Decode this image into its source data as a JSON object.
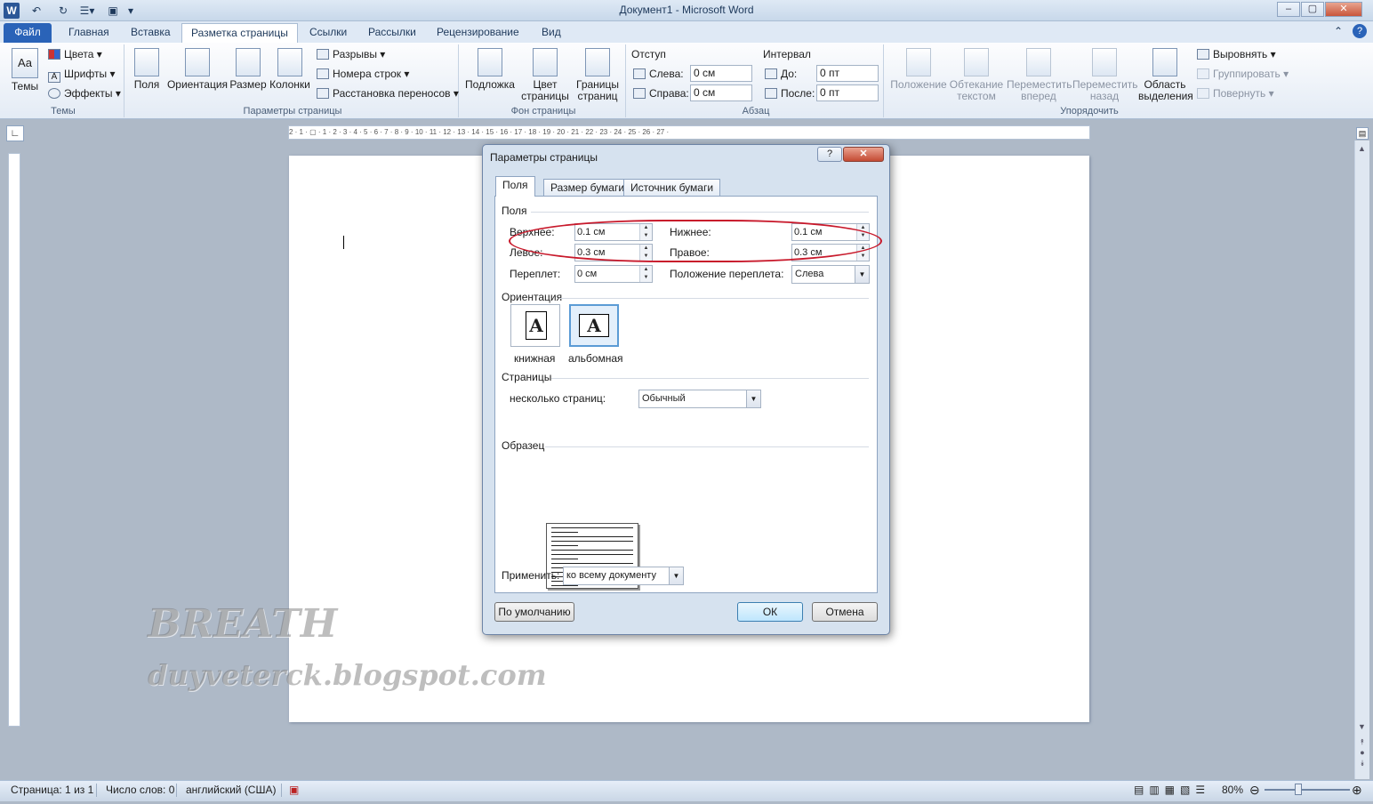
{
  "app": {
    "title": "Документ1  -  Microsoft Word"
  },
  "tabs": [
    "Файл",
    "Главная",
    "Вставка",
    "Разметка страницы",
    "Ссылки",
    "Рассылки",
    "Рецензирование",
    "Вид"
  ],
  "ribbon": {
    "themes": {
      "themes_label": "Темы",
      "colors": "Цвета",
      "fonts": "Шрифты",
      "effects": "Эффекты",
      "group": "Темы"
    },
    "page_setup": {
      "margins": "Поля",
      "orientation": "Ориентация",
      "size": "Размер",
      "columns": "Колонки",
      "breaks": "Разрывы",
      "line_numbers": "Номера строк",
      "hyphenation": "Расстановка переносов",
      "group": "Параметры страницы"
    },
    "background": {
      "watermark": "Подложка",
      "page_color_1": "Цвет",
      "page_color_2": "страницы",
      "page_borders_1": "Границы",
      "page_borders_2": "страниц",
      "group": "Фон страницы"
    },
    "paragraph": {
      "indent": "Отступ",
      "left": "Слева:",
      "right": "Справа:",
      "left_val": "0 см",
      "right_val": "0 см",
      "spacing": "Интервал",
      "before": "До:",
      "after": "После:",
      "before_val": "0 пт",
      "after_val": "0 пт",
      "group": "Абзац"
    },
    "arrange": {
      "position": "Положение",
      "wrap_1": "Обтекание",
      "wrap_2": "текстом",
      "forward_1": "Переместить",
      "forward_2": "вперед",
      "backward_1": "Переместить",
      "backward_2": "назад",
      "selection_1": "Область",
      "selection_2": "выделения",
      "align": "Выровнять",
      "group_btn": "Группировать",
      "rotate": "Повернуть",
      "group": "Упорядочить"
    }
  },
  "dialog": {
    "title": "Параметры страницы",
    "tabs": [
      "Поля",
      "Размер бумаги",
      "Источник бумаги"
    ],
    "margins_section": "Поля",
    "top_label": "Верхнее:",
    "top_value": "0.1 см",
    "bottom_label": "Нижнее:",
    "bottom_value": "0.1 см",
    "left_label": "Левое:",
    "left_value": "0.3 см",
    "right_label": "Правое:",
    "right_value": "0.3 см",
    "gutter_label": "Переплет:",
    "gutter_value": "0 см",
    "gutter_pos_label": "Положение переплета:",
    "gutter_pos_value": "Слева",
    "orientation_section": "Ориентация",
    "portrait": "книжная",
    "landscape": "альбомная",
    "orient_glyph": "A",
    "pages_section": "Страницы",
    "multiple_pages_label": "несколько страниц:",
    "multiple_pages_value": "Обычный",
    "preview_section": "Образец",
    "apply_label": "Применить:",
    "apply_value": "ко всему документу",
    "default_btn": "По умолчанию",
    "ok_btn": "ОК",
    "cancel_btn": "Отмена",
    "help": "?",
    "close": "✕"
  },
  "watermark": {
    "line1": "BREATH",
    "line2": "duyveterck.blogspot.com"
  },
  "status": {
    "page": "Страница: 1 из 1",
    "words": "Число слов: 0",
    "lang": "английский (США)",
    "zoom": "80%"
  },
  "ruler_text": "2 · 1 · ▢ · 1 · 2 · 3 · 4 · 5 · 6 · 7 · 8 · 9 · 10 · 11 · 12 · 13 · 14 · 15 · 16 · 17 · 18 · 19 · 20 · 21 · 22 · 23 · 24 · 25 · 26 · 27 ·",
  "colors": {
    "accent": "#2a63b8",
    "highlight": "#c8192b"
  }
}
